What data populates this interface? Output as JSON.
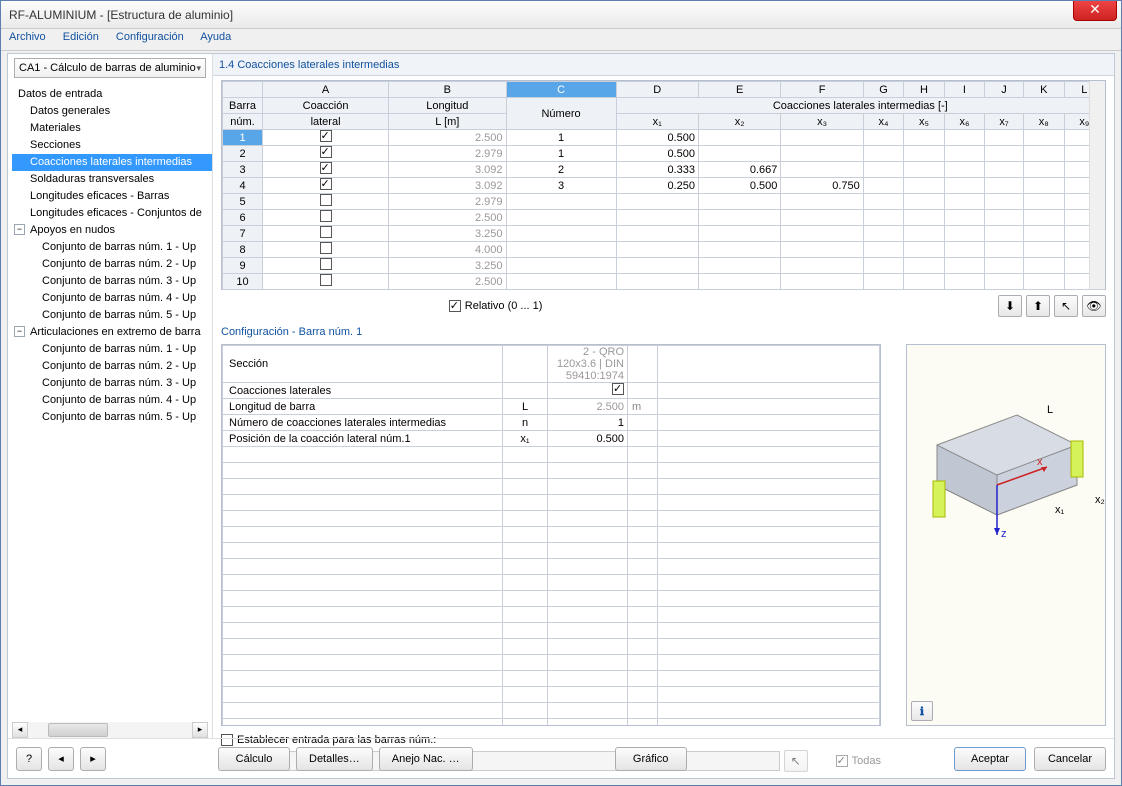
{
  "window": {
    "title": "RF-ALUMINIUM - [Estructura de aluminio]"
  },
  "menu": [
    "Archivo",
    "Edición",
    "Configuración",
    "Ayuda"
  ],
  "combo": "CA1 - Cálculo de barras de aluminio",
  "tree": {
    "root": "Datos de entrada",
    "items": [
      "Datos generales",
      "Materiales",
      "Secciones",
      "Coacciones laterales intermedias",
      "Soldaduras transversales",
      "Longitudes eficaces - Barras",
      "Longitudes eficaces - Conjuntos de"
    ],
    "group1": "Apoyos en nudos",
    "group1items": [
      "Conjunto de barras núm. 1 - Up",
      "Conjunto de barras núm. 2 - Up",
      "Conjunto de barras núm. 3 - Up",
      "Conjunto de barras núm. 4 - Up",
      "Conjunto de barras núm. 5 - Up"
    ],
    "group2": "Articulaciones en extremo de barra",
    "group2items": [
      "Conjunto de barras núm. 1 - Up",
      "Conjunto de barras núm. 2 - Up",
      "Conjunto de barras núm. 3 - Up",
      "Conjunto de barras núm. 4 - Up",
      "Conjunto de barras núm. 5 - Up"
    ]
  },
  "header": "1.4 Coacciones laterales intermedias",
  "cols": {
    "letters": [
      "A",
      "B",
      "C",
      "D",
      "E",
      "F",
      "G",
      "H",
      "I",
      "J",
      "K",
      "L"
    ],
    "h1": "Barra",
    "h1b": "núm.",
    "h2": "Coacción",
    "h2b": "lateral",
    "h3": "Longitud",
    "h3b": "L [m]",
    "h4": "Número",
    "hspan": "Coacciones laterales intermedias [-]",
    "x": [
      "x₁",
      "x₂",
      "x₃",
      "x₄",
      "x₅",
      "x₆",
      "x₇",
      "x₈",
      "x₉"
    ]
  },
  "rows": [
    {
      "n": "1",
      "c": true,
      "L": "2.500",
      "num": "1",
      "x": [
        "0.500",
        "",
        "",
        "",
        "",
        "",
        "",
        "",
        ""
      ]
    },
    {
      "n": "2",
      "c": true,
      "L": "2.979",
      "num": "1",
      "x": [
        "0.500",
        "",
        "",
        "",
        "",
        "",
        "",
        "",
        ""
      ]
    },
    {
      "n": "3",
      "c": true,
      "L": "3.092",
      "num": "2",
      "x": [
        "0.333",
        "0.667",
        "",
        "",
        "",
        "",
        "",
        "",
        ""
      ]
    },
    {
      "n": "4",
      "c": true,
      "L": "3.092",
      "num": "3",
      "x": [
        "0.250",
        "0.500",
        "0.750",
        "",
        "",
        "",
        "",
        "",
        ""
      ]
    },
    {
      "n": "5",
      "c": false,
      "L": "2.979",
      "num": "",
      "x": [
        "",
        "",
        "",
        "",
        "",
        "",
        "",
        "",
        ""
      ]
    },
    {
      "n": "6",
      "c": false,
      "L": "2.500",
      "num": "",
      "x": [
        "",
        "",
        "",
        "",
        "",
        "",
        "",
        "",
        ""
      ]
    },
    {
      "n": "7",
      "c": false,
      "L": "3.250",
      "num": "",
      "x": [
        "",
        "",
        "",
        "",
        "",
        "",
        "",
        "",
        ""
      ]
    },
    {
      "n": "8",
      "c": false,
      "L": "4.000",
      "num": "",
      "x": [
        "",
        "",
        "",
        "",
        "",
        "",
        "",
        "",
        ""
      ]
    },
    {
      "n": "9",
      "c": false,
      "L": "3.250",
      "num": "",
      "x": [
        "",
        "",
        "",
        "",
        "",
        "",
        "",
        "",
        ""
      ]
    },
    {
      "n": "10",
      "c": false,
      "L": "2.500",
      "num": "",
      "x": [
        "",
        "",
        "",
        "",
        "",
        "",
        "",
        "",
        ""
      ]
    }
  ],
  "relative": "Relativo (0 ... 1)",
  "config": {
    "title": "Configuración - Barra núm. 1",
    "rows": [
      {
        "label": "Sección",
        "sym": "",
        "val": "2 - QRO 120x3.6 | DIN 59410:1974",
        "unit": "",
        "grey": true
      },
      {
        "label": "Coacciones laterales",
        "sym": "",
        "val": "☑",
        "unit": "",
        "chk": true
      },
      {
        "label": "Longitud de barra",
        "sym": "L",
        "val": "2.500",
        "unit": "m",
        "grey": true
      },
      {
        "label": "Número de coacciones laterales intermedias",
        "sym": "n",
        "val": "1",
        "unit": ""
      },
      {
        "label": "Posición de la coacción lateral núm.1",
        "sym": "x₁",
        "val": "0.500",
        "unit": ""
      }
    ]
  },
  "establish": {
    "label": "Establecer entrada para las barras núm.:",
    "todas": "Todas"
  },
  "footer": {
    "calc": "Cálculo",
    "det": "Detalles…",
    "anejo": "Anejo Nac. …",
    "graf": "Gráfico",
    "ok": "Aceptar",
    "cancel": "Cancelar"
  }
}
